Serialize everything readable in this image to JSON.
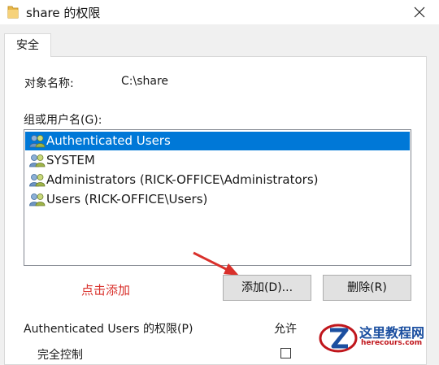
{
  "window": {
    "title": "share 的权限"
  },
  "tabs": [
    {
      "label": "安全"
    }
  ],
  "object": {
    "label": "对象名称:",
    "value": "C:\\share"
  },
  "groups": {
    "label": "组或用户名(G):",
    "items": [
      {
        "label": "Authenticated Users",
        "selected": true
      },
      {
        "label": "SYSTEM",
        "selected": false
      },
      {
        "label": "Administrators (RICK-OFFICE\\Administrators)",
        "selected": false
      },
      {
        "label": "Users (RICK-OFFICE\\Users)",
        "selected": false
      }
    ]
  },
  "buttons": {
    "add": "添加(D)...",
    "remove": "删除(R)"
  },
  "annotation": {
    "hint": "点击添加",
    "color": "#d9302b"
  },
  "permissions": {
    "label": "Authenticated Users 的权限(P)",
    "allow_header": "允许",
    "rows": [
      {
        "label": "完全控制"
      }
    ]
  },
  "watermark": {
    "name": "这里教程网",
    "url": "herecours.com"
  },
  "colors": {
    "selection": "#0078d7",
    "accent_red": "#d9302b"
  }
}
